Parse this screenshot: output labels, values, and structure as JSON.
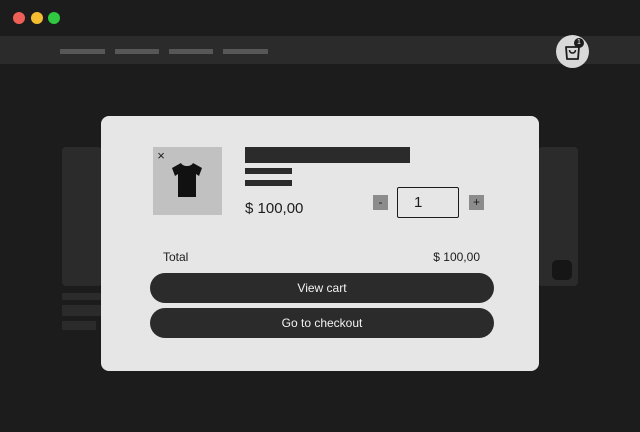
{
  "cart": {
    "badge_count": "1",
    "item": {
      "price": "$ 100,00",
      "quantity": "1",
      "minus_label": "-",
      "plus_label": "+",
      "remove_label": "×"
    },
    "total_label": "Total",
    "total_value": "$ 100,00",
    "view_cart_label": "View cart",
    "checkout_label": "Go to checkout"
  },
  "icons": {
    "cart": "shopping-bag-icon",
    "product": "tshirt-icon",
    "remove": "close-icon"
  },
  "colors": {
    "background": "#1c1c1c",
    "navbar": "#2b2b2b",
    "modal": "#e6e6e6",
    "button": "#2b2b2b",
    "close": "#ee5f57",
    "minimize": "#f5bd30",
    "maximize": "#2fc840"
  }
}
